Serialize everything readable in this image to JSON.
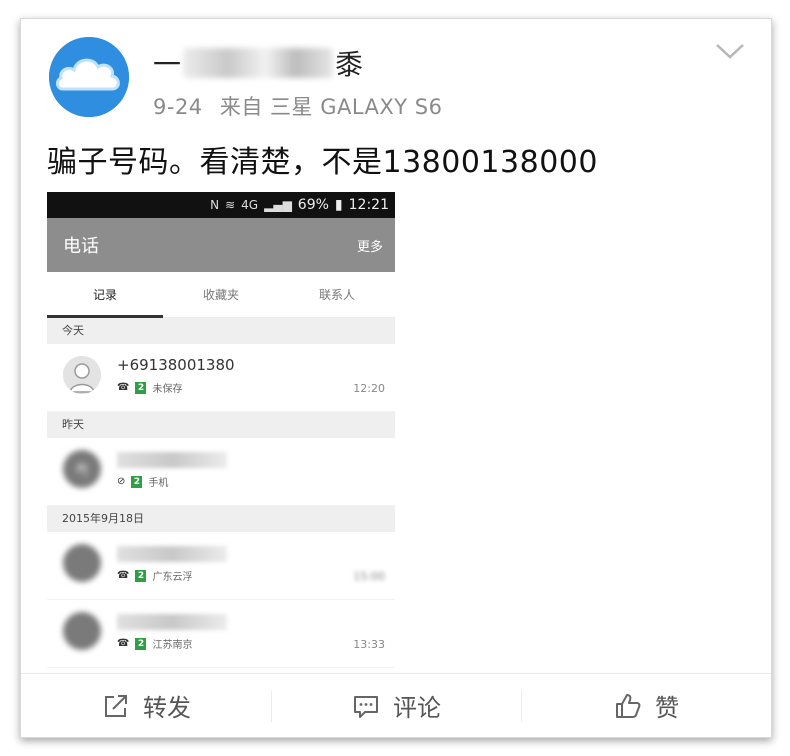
{
  "post": {
    "username_prefix": "一",
    "username_suffix": "黍",
    "date": "9-24",
    "source": "来自 三星 GALAXY S6",
    "text": "骗子号码。看清楚，不是13800138000"
  },
  "phone": {
    "status": {
      "n_icon": "N",
      "network": "4G",
      "battery": "69%",
      "time": "12:21"
    },
    "appbar": {
      "title": "电话",
      "more": "更多"
    },
    "tabs": [
      "记录",
      "收藏夹",
      "联系人"
    ],
    "sections": {
      "today": "今天",
      "yesterday": "昨天",
      "date": "2015年9月18日"
    },
    "calls": [
      {
        "number": "+69138001380",
        "sim": "2",
        "label": "未保存",
        "time": "12:20"
      },
      {
        "sim": "2",
        "label": "手机",
        "avatar_text": "PJ"
      },
      {
        "sim": "2",
        "label": "广东云浮",
        "time": "15:00"
      },
      {
        "sim": "2",
        "label": "江苏南京",
        "time": "13:33"
      }
    ]
  },
  "actions": {
    "repost": "转发",
    "comment": "评论",
    "like": "赞"
  },
  "icons": {
    "avatar": "cloud-avatar-icon",
    "dropdown": "chevron-down-icon",
    "repost": "share-icon",
    "comment": "comment-icon",
    "like": "thumbs-up-icon"
  }
}
